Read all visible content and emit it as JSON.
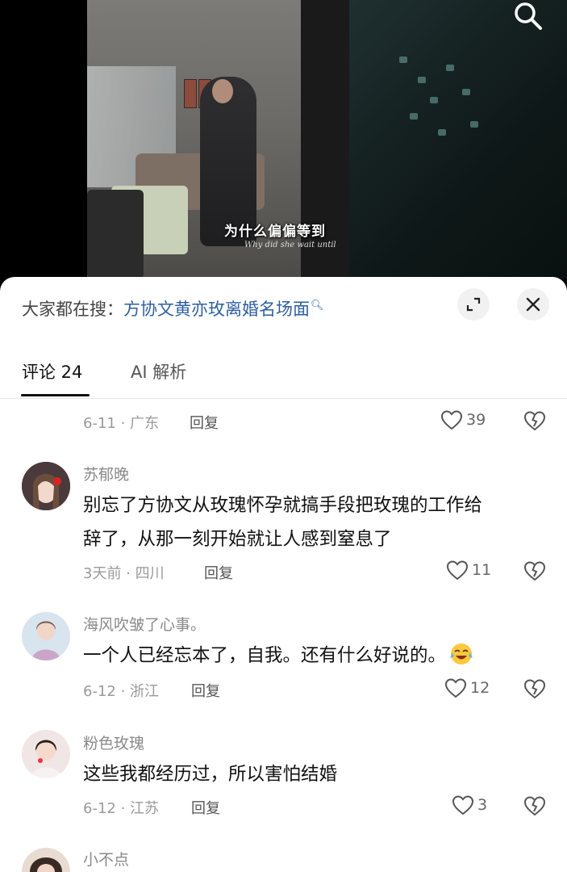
{
  "video": {
    "subtitle_cn": "为什么偏偏等到",
    "subtitle_en": "Why did she wait until"
  },
  "search": {
    "prefix": "大家都在搜：",
    "query": "方协文黄亦玫离婚名场面"
  },
  "tabs": [
    {
      "label": "评论 24"
    },
    {
      "label": "AI 解析"
    }
  ],
  "first_meta": {
    "date_loc": "6-11 · 广东",
    "reply": "回复",
    "likes": "39"
  },
  "comments": [
    {
      "author": "苏郁晚",
      "lines": [
        "别忘了方协文从玫瑰怀孕就搞手段把玫瑰的工作给",
        "辞了，从那一刻开始就让人感到窒息了"
      ],
      "date_loc": "3天前 · 四川",
      "reply": "回复",
      "likes": "11"
    },
    {
      "author": "海风吹皱了心事。",
      "lines": [
        "一个人已经忘本了，自我。还有什么好说的。"
      ],
      "date_loc": "6-12 · 浙江",
      "reply": "回复",
      "likes": "12"
    },
    {
      "author": "粉色玫瑰",
      "lines": [
        "这些我都经历过，所以害怕结婚"
      ],
      "date_loc": "6-12 · 江苏",
      "reply": "回复",
      "likes": "3"
    },
    {
      "author": "小不点"
    }
  ],
  "colors": {
    "link": "#2d5f9e",
    "muted": "#9a9a9a",
    "text": "#111111"
  },
  "icons": [
    "search-icon",
    "expand-icon",
    "close-icon",
    "heart-icon",
    "broken-heart-icon",
    "crying-laughing-emoji"
  ]
}
